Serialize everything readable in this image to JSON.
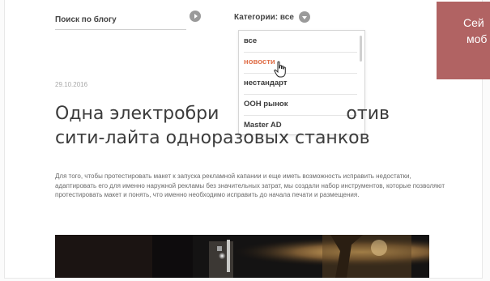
{
  "search": {
    "placeholder": "Поиск по блогу"
  },
  "category": {
    "label": "Категории:",
    "selected": "все",
    "options": [
      "все",
      "новости",
      "нестандарт",
      "OOH рынок",
      "Master AD"
    ],
    "hovered_option": "новости"
  },
  "banner": {
    "text_line1": "Сей",
    "text_line2": "моб"
  },
  "article": {
    "date": "29.10.2016",
    "title_line1": "Одна электробри",
    "title_line1_end": "отив",
    "title_line2": "сити-лайта одноразовых станков",
    "body": "Для того, чтобы протестировать макет к запуска рекламной капании и еще иметь возможность исправить недостатки, адаптировать его для именно наружной рекламы без значительных затрат, мы создали набор инструментов, которые позволяют протестировать макет и понять, что именно необходимо исправить до начала печати и размещения."
  },
  "colors": {
    "accent_orange": "#e0704a",
    "banner_bg": "#b16363",
    "button_gray": "#9a9a9a"
  },
  "icons": {
    "search_submit": "chevron-right-icon",
    "category_toggle": "chevron-down-icon",
    "cursor": "hand-pointer-icon"
  }
}
